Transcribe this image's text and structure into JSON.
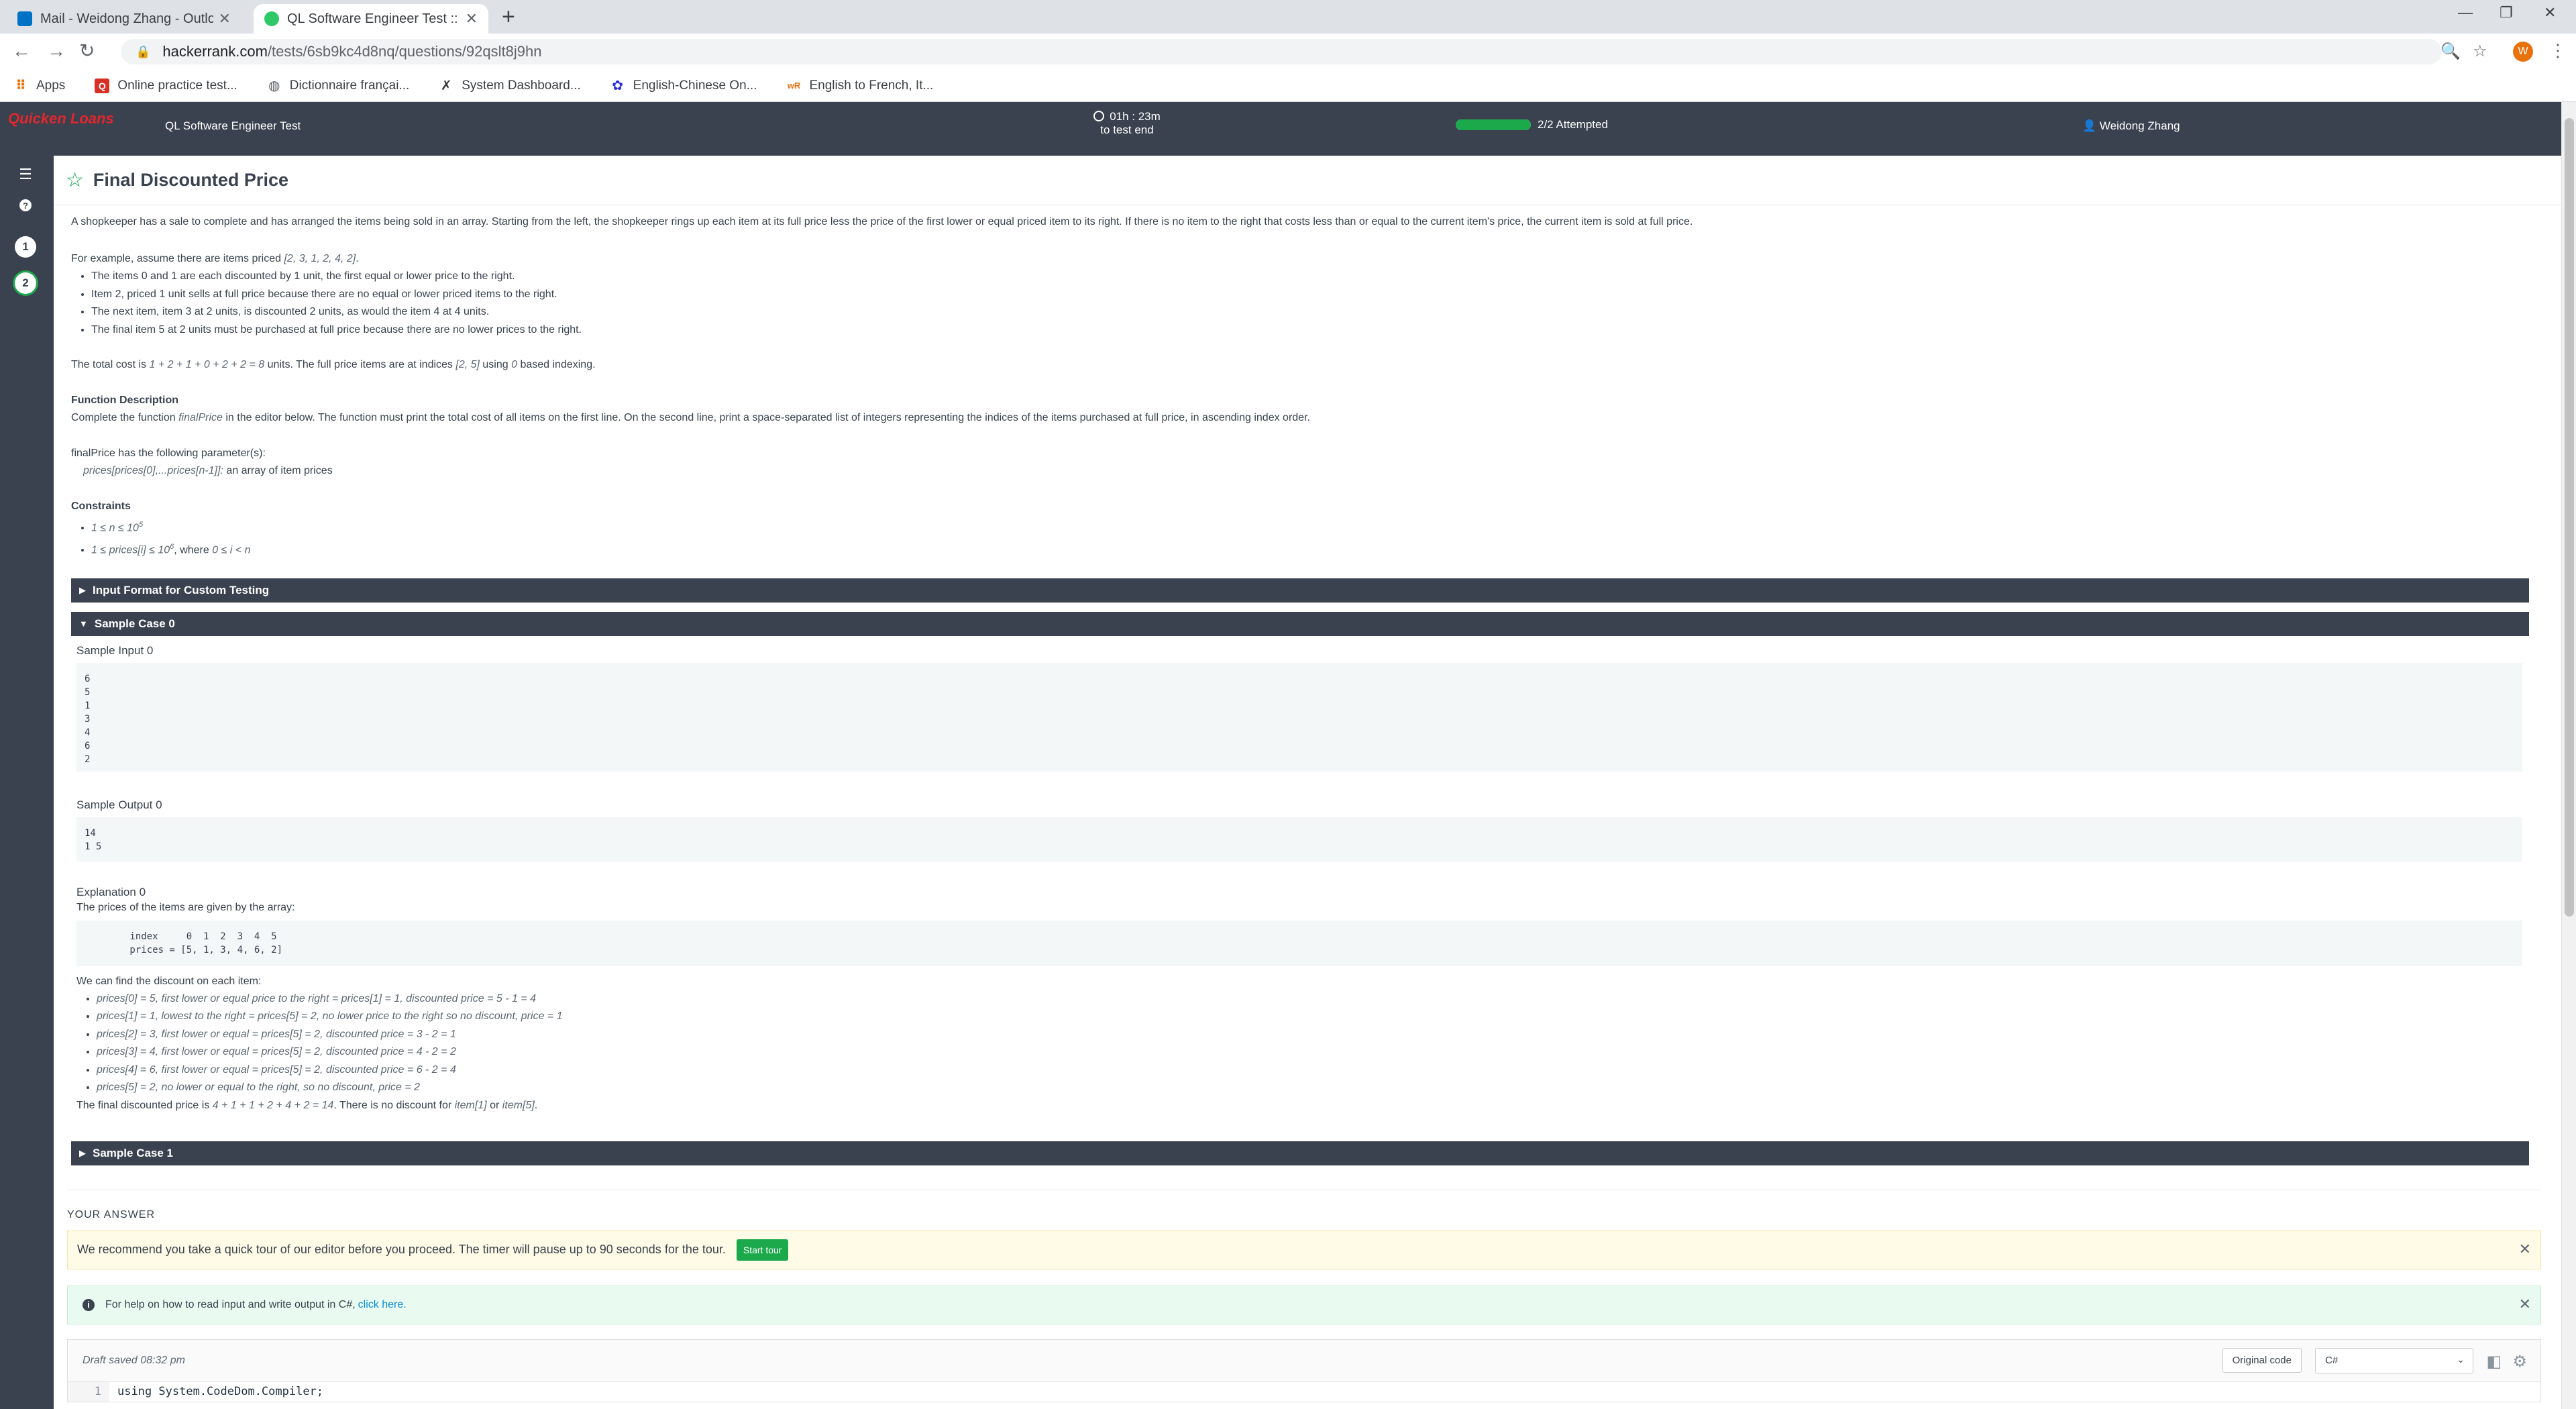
{
  "browser": {
    "tabs": [
      {
        "label": "Mail - Weidong Zhang - Outlook",
        "icon": "outlook-icon",
        "color": "#0072c6"
      },
      {
        "label": "QL Software Engineer Test :: pow",
        "icon": "hackerrank-icon",
        "color": "#2ec866"
      }
    ],
    "new_tab": "+",
    "url_host": "hackerrank.com",
    "url_path": "/tests/6sb9kc4d8nq/questions/92qslt8j9hn",
    "profile_initial": "W",
    "bookmarks": [
      {
        "label": "Apps",
        "icon": "apps-grid-icon",
        "color": "#e8710a"
      },
      {
        "label": "Online practice test...",
        "icon": "qa-icon",
        "color": "#d93025"
      },
      {
        "label": "Dictionnaire françai...",
        "icon": "dictionary-icon",
        "color": "#5f6368"
      },
      {
        "label": "System Dashboard...",
        "icon": "jira-icon",
        "color": "#333333"
      },
      {
        "label": "English-Chinese On...",
        "icon": "paw-icon",
        "color": "#2932e1"
      },
      {
        "label": "English to French, It...",
        "icon": "wordreference-icon",
        "color": "#e8710a"
      }
    ]
  },
  "app": {
    "brand": "Quicken Loans",
    "test_name": "QL Software Engineer Test",
    "timer_value": "01h : 23m",
    "timer_sub": "to test end",
    "progress_label": "2/2 Attempted",
    "progress_fraction": 1.0,
    "user_name": "Weidong Zhang",
    "rail": {
      "q1": "1",
      "q2": "2"
    }
  },
  "question": {
    "title": "Final Discounted Price",
    "intro": "A shopkeeper has a sale to complete and has arranged the items being sold in an array. Starting from the left, the shopkeeper rings up each item at its full price less the price of the first lower or equal priced item to its right. If there is no item to the right that costs less than or equal to the current item's price, the current item is sold at full price.",
    "example_lead": "For example, assume there are items priced ",
    "example_arr": "[2, 3, 1, 2, 4, 2]",
    "example_tail": ".",
    "bullets": [
      "The items 0 and 1 are each discounted by 1 unit, the first equal or lower price to the right.",
      "Item 2, priced 1 unit sells at full price because there are no equal or lower priced items to the right.",
      "The next item, item 3 at 2 units, is discounted 2 units, as would the item 4 at 4 units.",
      "The final item 5 at 2 units must be purchased at full price because there are no lower prices to the right."
    ],
    "total_a": "The total cost is ",
    "total_expr": "1 + 2 + 1 + 0 + 2 + 2 = 8",
    "total_b": " units. The full price items are at indices ",
    "total_idx": "[2, 5]",
    "total_c": " using ",
    "total_zero": "0",
    "total_d": " based indexing.",
    "func_heading": "Function Description",
    "func_a": "Complete the function ",
    "func_name": "finalPrice",
    "func_b": " in the editor below. The function must print the total cost of all items on the first line. On the second line, print a space-separated list of integers representing the indices of the items purchased at full price, in ascending index order.",
    "param_intro": "finalPrice has the following parameter(s):",
    "param_name": "prices[prices[0],...prices[n-1]]:",
    "param_desc": "  an array of item prices",
    "constraints_heading": "Constraints",
    "constraint_1a": "1 ≤ n ≤ 10",
    "constraint_1sup": "5",
    "constraint_2a": "1 ≤ prices[i] ≤ 10",
    "constraint_2sup": "6",
    "constraint_2b": ", where ",
    "constraint_2c": "0 ≤ i < n"
  },
  "sections": {
    "input_format": "Input Format for Custom Testing",
    "sample0": "Sample Case 0",
    "sample1": "Sample Case 1"
  },
  "sample0": {
    "input_label": "Sample Input 0",
    "input": "6\n5\n1\n3\n4\n6\n2",
    "output_label": "Sample Output 0",
    "output": "14\n1 5",
    "explanation_label": "Explanation 0",
    "explanation_lead": "The prices of the items are given by the array:",
    "array_block": "        index     0  1  2  3  4  5\n        prices = [5, 1, 3, 4, 6, 2]",
    "discount_lead": "We can find the discount on each item:",
    "discounts": [
      "prices[0] = 5, first lower or equal price to the right = prices[1] = 1, discounted price = 5 - 1 = 4",
      "prices[1] = 1, lowest to the right = prices[5] = 2, no lower price to the right so no discount, price = 1",
      "prices[2] = 3, first lower or equal = prices[5] = 2, discounted price = 3 - 2 = 1",
      "prices[3] = 4, first lower or equal = prices[5] = 2, discounted price = 4 - 2 = 2",
      "prices[4] = 6, first lower or equal = prices[5] = 2, discounted price = 6 - 2 = 4",
      "prices[5] = 2, no lower or equal to the right, so no discount, price = 2"
    ],
    "final_a": "The final discounted price is ",
    "final_expr": "4 + 1 + 1 + 2 + 4 + 2 = 14",
    "final_b": ". There is no discount for ",
    "final_i1": "item[1]",
    "final_c": " or ",
    "final_i5": "item[5]",
    "final_d": "."
  },
  "answer": {
    "heading": "YOUR ANSWER",
    "tour_text": "We recommend you take a quick tour of our editor before you proceed. The timer will pause up to 90 seconds for the tour.",
    "tour_button": "Start tour",
    "help_text": "For help on how to read input and write output in C#,",
    "help_link": "click here.",
    "draft": "Draft saved 08:32 pm",
    "original_code": "Original code",
    "language": "C#",
    "line_no": "1",
    "code_line": "using System.CodeDom.Compiler;"
  }
}
